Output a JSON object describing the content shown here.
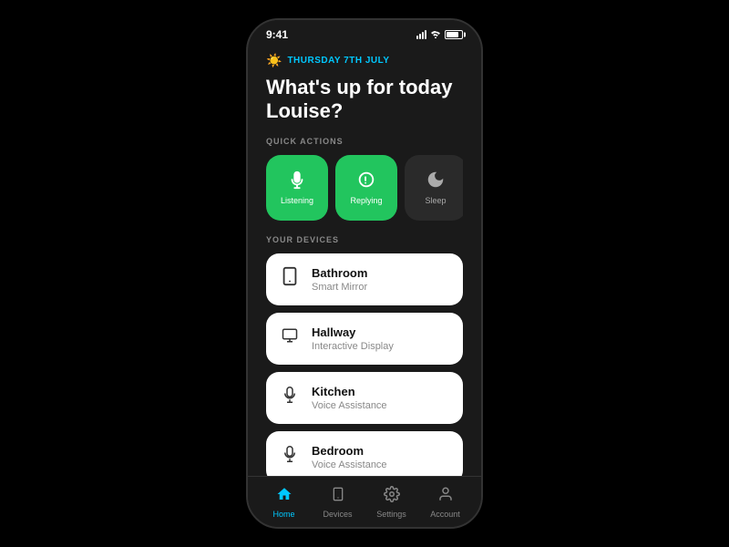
{
  "phone": {
    "status_bar": {
      "time": "9:41"
    },
    "date_row": {
      "icon": "☀️",
      "date_text": "THURSDAY 7TH JULY"
    },
    "greeting": "What's up for today Louise?",
    "quick_actions": {
      "label": "QUICK ACTIONS",
      "items": [
        {
          "id": "listening",
          "label": "Listening",
          "style": "green"
        },
        {
          "id": "replying",
          "label": "Replying",
          "style": "green"
        },
        {
          "id": "sleep",
          "label": "Sleep",
          "style": "dark"
        },
        {
          "id": "extra",
          "label": "",
          "style": "green"
        }
      ]
    },
    "devices": {
      "label": "YOUR DEVICES",
      "items": [
        {
          "id": "bathroom",
          "name": "Bathroom",
          "type": "Smart Mirror",
          "icon": "tablet"
        },
        {
          "id": "hallway",
          "name": "Hallway",
          "type": "Interactive Display",
          "icon": "monitor"
        },
        {
          "id": "kitchen",
          "name": "Kitchen",
          "type": "Voice Assistance",
          "icon": "mic"
        },
        {
          "id": "bedroom",
          "name": "Bedroom",
          "type": "Voice Assistance",
          "icon": "mic"
        }
      ]
    },
    "bottom_nav": {
      "items": [
        {
          "id": "home",
          "label": "Home",
          "active": true
        },
        {
          "id": "devices",
          "label": "Devices",
          "active": false
        },
        {
          "id": "settings",
          "label": "Settings",
          "active": false
        },
        {
          "id": "account",
          "label": "Account",
          "active": false
        }
      ]
    }
  }
}
